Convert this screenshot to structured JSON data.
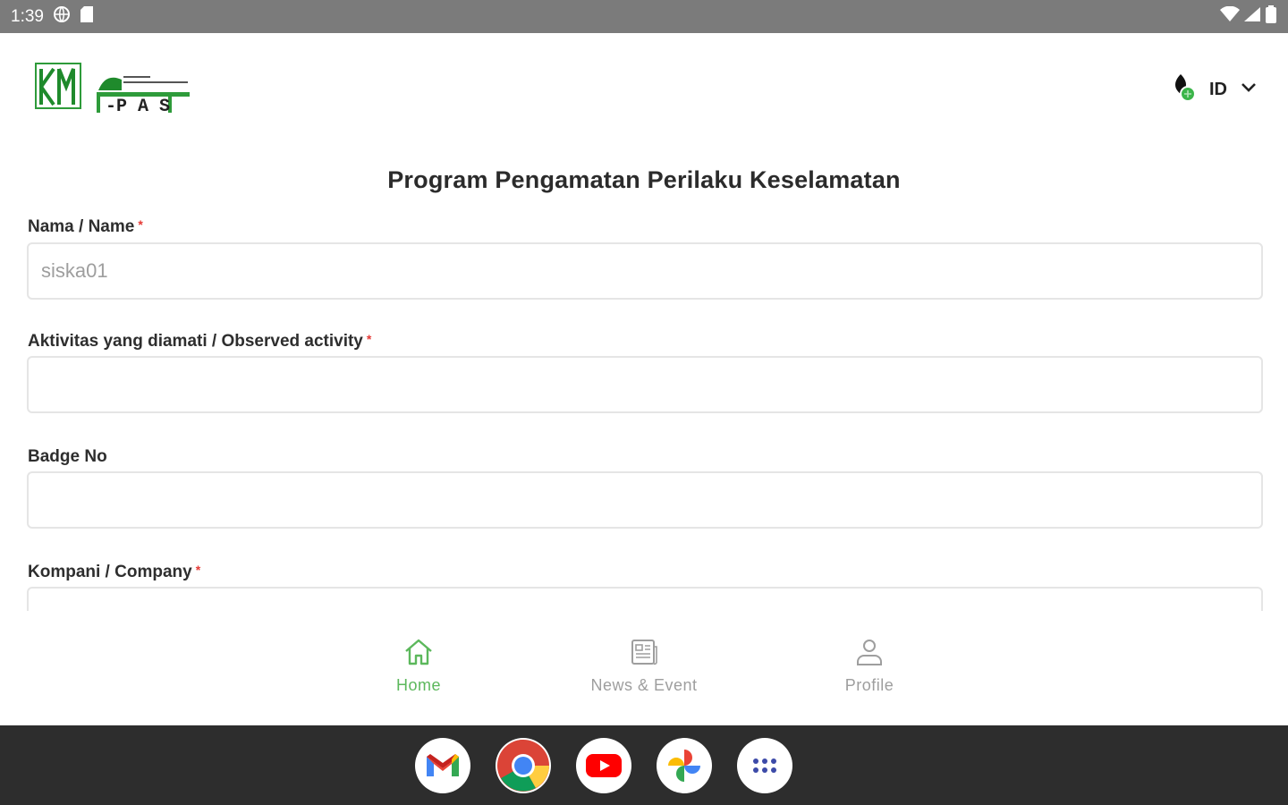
{
  "status_bar": {
    "time": "1:39"
  },
  "header": {
    "language_code": "ID"
  },
  "form": {
    "title": "Program Pengamatan Perilaku Keselamatan",
    "fields": [
      {
        "label": "Nama / Name",
        "required": true,
        "value": "siska01"
      },
      {
        "label": "Aktivitas yang diamati / Observed activity",
        "required": true,
        "value": ""
      },
      {
        "label": "Badge No",
        "required": false,
        "value": ""
      },
      {
        "label": "Kompani / Company",
        "required": true,
        "value": ""
      }
    ],
    "required_marker": "*"
  },
  "bottom_nav": {
    "items": [
      {
        "label": "Home",
        "icon": "home-icon",
        "active": true
      },
      {
        "label": "News & Event",
        "icon": "newspaper-icon",
        "active": false
      },
      {
        "label": "Profile",
        "icon": "person-icon",
        "active": false
      }
    ]
  },
  "dock": {
    "apps": [
      {
        "name": "gmail-icon"
      },
      {
        "name": "chrome-icon"
      },
      {
        "name": "youtube-icon"
      },
      {
        "name": "photos-icon"
      },
      {
        "name": "app-drawer-icon"
      }
    ]
  },
  "colors": {
    "accent": "#5cb85c",
    "required": "#e53935",
    "status_bar": "#7b7b7b",
    "dock": "#2d2d2d"
  }
}
